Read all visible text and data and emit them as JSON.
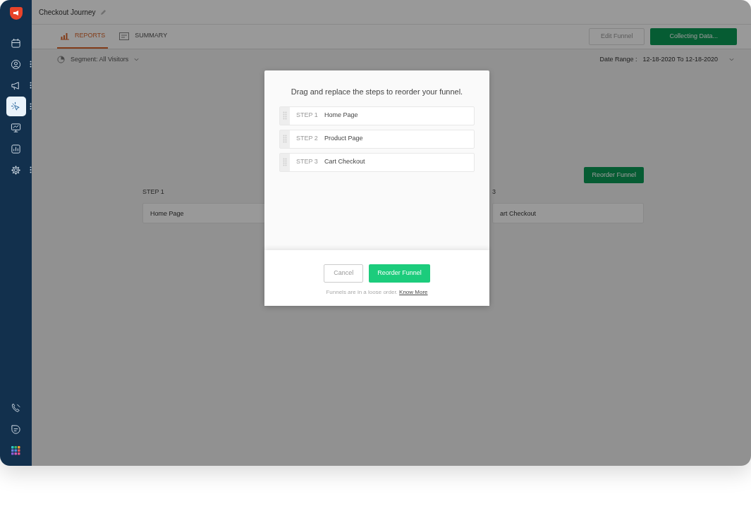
{
  "sidebar": {
    "top": [
      {
        "kind": "calendar",
        "selected": false,
        "menu": false
      },
      {
        "kind": "user",
        "selected": false,
        "menu": true
      },
      {
        "kind": "megaphone",
        "selected": false,
        "menu": true
      },
      {
        "kind": "cursor",
        "selected": true,
        "menu": true
      },
      {
        "kind": "monitor",
        "selected": false,
        "menu": false
      },
      {
        "kind": "chart",
        "selected": false,
        "menu": false
      },
      {
        "kind": "gear",
        "selected": false,
        "menu": true
      }
    ],
    "bottom": [
      {
        "kind": "phone"
      },
      {
        "kind": "chat"
      },
      {
        "kind": "apps"
      }
    ]
  },
  "header": {
    "title": "Checkout Journey"
  },
  "tabs": [
    {
      "label": "REPORTS",
      "kind": "chart",
      "selected": true
    },
    {
      "label": "SUMMARY",
      "kind": "doc",
      "selected": false
    }
  ],
  "actions": [
    {
      "label": "Edit Funnel",
      "disabled": true
    },
    {
      "label": "Collecting Data...",
      "disabled": false
    }
  ],
  "segment": "Segment: All Visitors",
  "date_range": {
    "label": "Date Range :",
    "value": "12-18-2020 To 12-18-2020"
  },
  "reorder_button": "Reorder Funnel",
  "steps": [
    {
      "label": "STEP 1",
      "name": "Home Page"
    },
    {
      "label": "3",
      "name": "art Checkout"
    }
  ],
  "modal": {
    "title": "Drag and replace the steps to reorder your funnel.",
    "steps": [
      {
        "label": "STEP 1",
        "name": "Home Page"
      },
      {
        "label": "STEP 2",
        "name": "Product Page"
      },
      {
        "label": "STEP 3",
        "name": "Cart Checkout"
      }
    ],
    "cancel": "Cancel",
    "confirm": "Reorder Funnel",
    "note": "Funnels are in a loose order.",
    "link": "Know More"
  }
}
